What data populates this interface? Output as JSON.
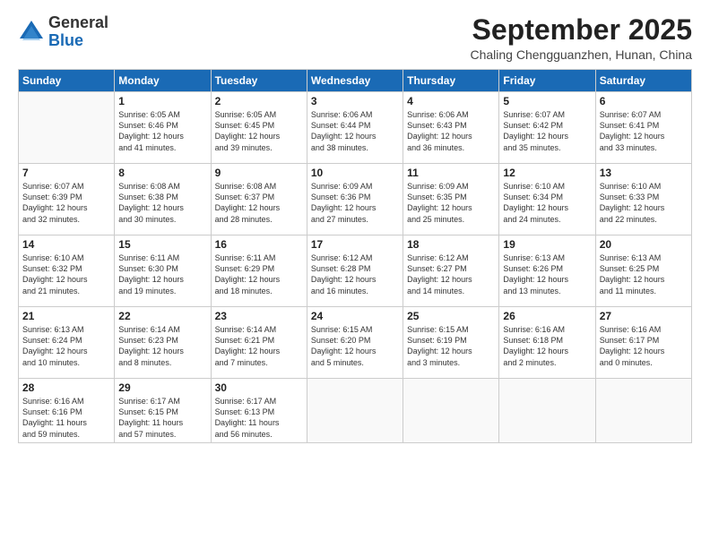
{
  "header": {
    "logo_general": "General",
    "logo_blue": "Blue",
    "month_title": "September 2025",
    "location": "Chaling Chengguanzhen, Hunan, China"
  },
  "weekdays": [
    "Sunday",
    "Monday",
    "Tuesday",
    "Wednesday",
    "Thursday",
    "Friday",
    "Saturday"
  ],
  "weeks": [
    [
      {
        "day": "",
        "lines": []
      },
      {
        "day": "1",
        "lines": [
          "Sunrise: 6:05 AM",
          "Sunset: 6:46 PM",
          "Daylight: 12 hours",
          "and 41 minutes."
        ]
      },
      {
        "day": "2",
        "lines": [
          "Sunrise: 6:05 AM",
          "Sunset: 6:45 PM",
          "Daylight: 12 hours",
          "and 39 minutes."
        ]
      },
      {
        "day": "3",
        "lines": [
          "Sunrise: 6:06 AM",
          "Sunset: 6:44 PM",
          "Daylight: 12 hours",
          "and 38 minutes."
        ]
      },
      {
        "day": "4",
        "lines": [
          "Sunrise: 6:06 AM",
          "Sunset: 6:43 PM",
          "Daylight: 12 hours",
          "and 36 minutes."
        ]
      },
      {
        "day": "5",
        "lines": [
          "Sunrise: 6:07 AM",
          "Sunset: 6:42 PM",
          "Daylight: 12 hours",
          "and 35 minutes."
        ]
      },
      {
        "day": "6",
        "lines": [
          "Sunrise: 6:07 AM",
          "Sunset: 6:41 PM",
          "Daylight: 12 hours",
          "and 33 minutes."
        ]
      }
    ],
    [
      {
        "day": "7",
        "lines": [
          "Sunrise: 6:07 AM",
          "Sunset: 6:39 PM",
          "Daylight: 12 hours",
          "and 32 minutes."
        ]
      },
      {
        "day": "8",
        "lines": [
          "Sunrise: 6:08 AM",
          "Sunset: 6:38 PM",
          "Daylight: 12 hours",
          "and 30 minutes."
        ]
      },
      {
        "day": "9",
        "lines": [
          "Sunrise: 6:08 AM",
          "Sunset: 6:37 PM",
          "Daylight: 12 hours",
          "and 28 minutes."
        ]
      },
      {
        "day": "10",
        "lines": [
          "Sunrise: 6:09 AM",
          "Sunset: 6:36 PM",
          "Daylight: 12 hours",
          "and 27 minutes."
        ]
      },
      {
        "day": "11",
        "lines": [
          "Sunrise: 6:09 AM",
          "Sunset: 6:35 PM",
          "Daylight: 12 hours",
          "and 25 minutes."
        ]
      },
      {
        "day": "12",
        "lines": [
          "Sunrise: 6:10 AM",
          "Sunset: 6:34 PM",
          "Daylight: 12 hours",
          "and 24 minutes."
        ]
      },
      {
        "day": "13",
        "lines": [
          "Sunrise: 6:10 AM",
          "Sunset: 6:33 PM",
          "Daylight: 12 hours",
          "and 22 minutes."
        ]
      }
    ],
    [
      {
        "day": "14",
        "lines": [
          "Sunrise: 6:10 AM",
          "Sunset: 6:32 PM",
          "Daylight: 12 hours",
          "and 21 minutes."
        ]
      },
      {
        "day": "15",
        "lines": [
          "Sunrise: 6:11 AM",
          "Sunset: 6:30 PM",
          "Daylight: 12 hours",
          "and 19 minutes."
        ]
      },
      {
        "day": "16",
        "lines": [
          "Sunrise: 6:11 AM",
          "Sunset: 6:29 PM",
          "Daylight: 12 hours",
          "and 18 minutes."
        ]
      },
      {
        "day": "17",
        "lines": [
          "Sunrise: 6:12 AM",
          "Sunset: 6:28 PM",
          "Daylight: 12 hours",
          "and 16 minutes."
        ]
      },
      {
        "day": "18",
        "lines": [
          "Sunrise: 6:12 AM",
          "Sunset: 6:27 PM",
          "Daylight: 12 hours",
          "and 14 minutes."
        ]
      },
      {
        "day": "19",
        "lines": [
          "Sunrise: 6:13 AM",
          "Sunset: 6:26 PM",
          "Daylight: 12 hours",
          "and 13 minutes."
        ]
      },
      {
        "day": "20",
        "lines": [
          "Sunrise: 6:13 AM",
          "Sunset: 6:25 PM",
          "Daylight: 12 hours",
          "and 11 minutes."
        ]
      }
    ],
    [
      {
        "day": "21",
        "lines": [
          "Sunrise: 6:13 AM",
          "Sunset: 6:24 PM",
          "Daylight: 12 hours",
          "and 10 minutes."
        ]
      },
      {
        "day": "22",
        "lines": [
          "Sunrise: 6:14 AM",
          "Sunset: 6:23 PM",
          "Daylight: 12 hours",
          "and 8 minutes."
        ]
      },
      {
        "day": "23",
        "lines": [
          "Sunrise: 6:14 AM",
          "Sunset: 6:21 PM",
          "Daylight: 12 hours",
          "and 7 minutes."
        ]
      },
      {
        "day": "24",
        "lines": [
          "Sunrise: 6:15 AM",
          "Sunset: 6:20 PM",
          "Daylight: 12 hours",
          "and 5 minutes."
        ]
      },
      {
        "day": "25",
        "lines": [
          "Sunrise: 6:15 AM",
          "Sunset: 6:19 PM",
          "Daylight: 12 hours",
          "and 3 minutes."
        ]
      },
      {
        "day": "26",
        "lines": [
          "Sunrise: 6:16 AM",
          "Sunset: 6:18 PM",
          "Daylight: 12 hours",
          "and 2 minutes."
        ]
      },
      {
        "day": "27",
        "lines": [
          "Sunrise: 6:16 AM",
          "Sunset: 6:17 PM",
          "Daylight: 12 hours",
          "and 0 minutes."
        ]
      }
    ],
    [
      {
        "day": "28",
        "lines": [
          "Sunrise: 6:16 AM",
          "Sunset: 6:16 PM",
          "Daylight: 11 hours",
          "and 59 minutes."
        ]
      },
      {
        "day": "29",
        "lines": [
          "Sunrise: 6:17 AM",
          "Sunset: 6:15 PM",
          "Daylight: 11 hours",
          "and 57 minutes."
        ]
      },
      {
        "day": "30",
        "lines": [
          "Sunrise: 6:17 AM",
          "Sunset: 6:13 PM",
          "Daylight: 11 hours",
          "and 56 minutes."
        ]
      },
      {
        "day": "",
        "lines": []
      },
      {
        "day": "",
        "lines": []
      },
      {
        "day": "",
        "lines": []
      },
      {
        "day": "",
        "lines": []
      }
    ]
  ]
}
